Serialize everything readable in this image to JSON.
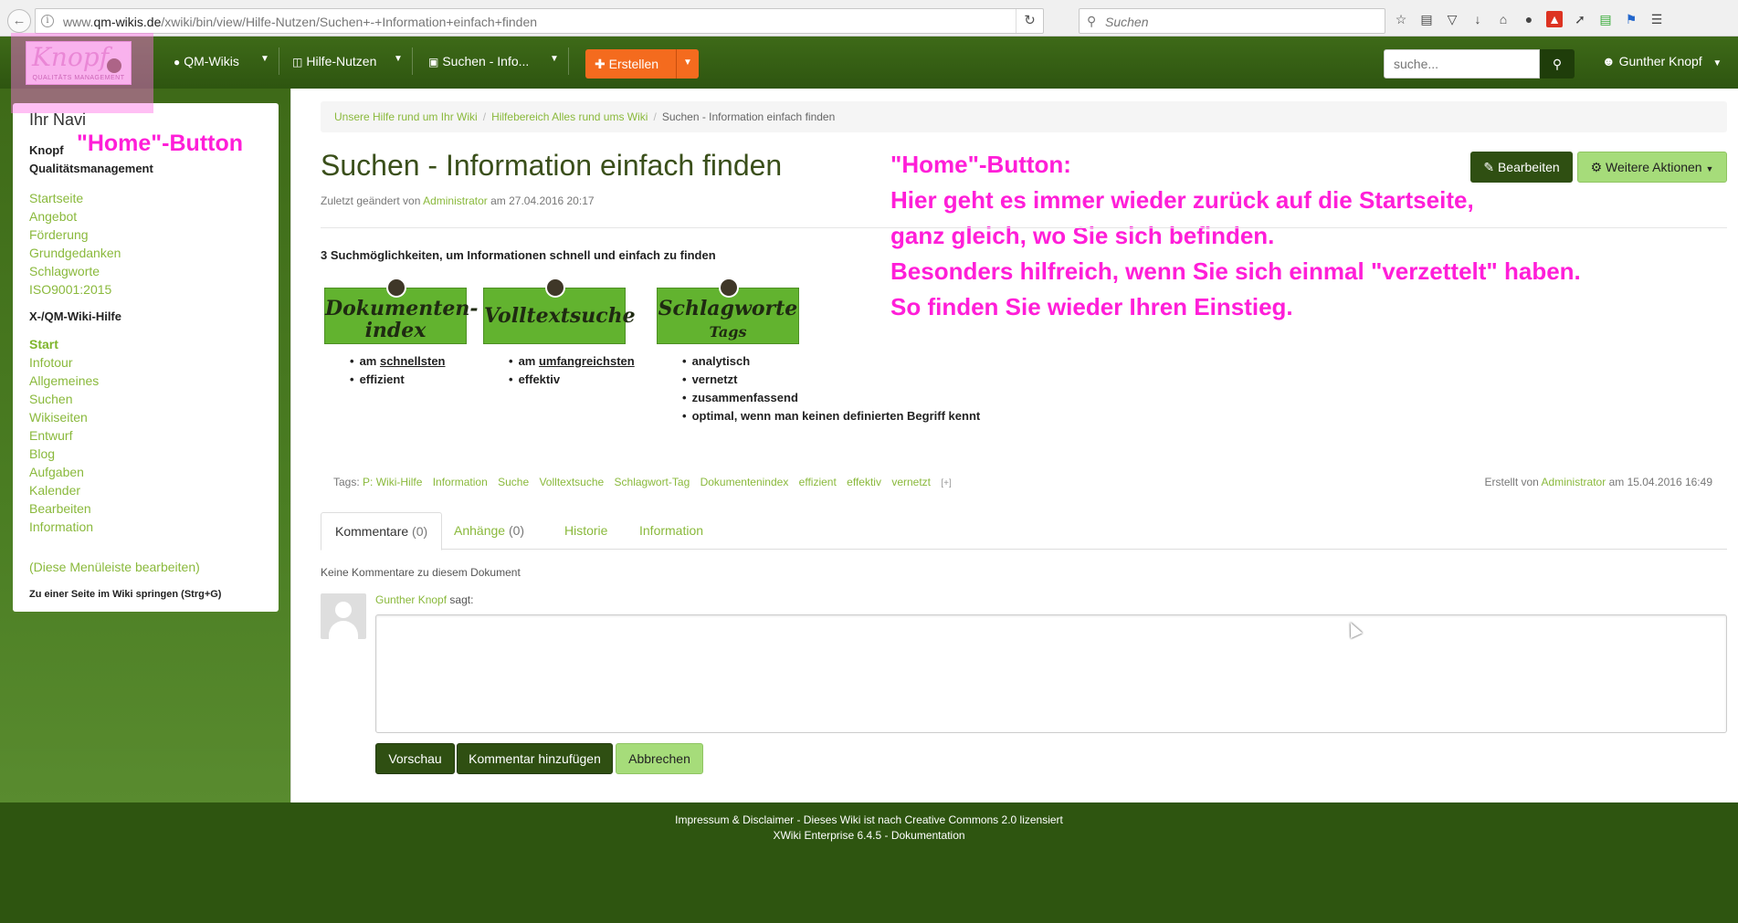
{
  "browser": {
    "url_prefix": "www.",
    "url_domain": "qm-wikis.de",
    "url_path": "/xwiki/bin/view/Hilfe-Nutzen/Suchen+-+Information+einfach+finden",
    "search_placeholder": "Suchen"
  },
  "header": {
    "logo_text": "Knopf",
    "logo_sub": "QUALITÄTS MANAGEMENT",
    "nav": [
      {
        "label": "QM-Wikis",
        "icon": "globe-icon"
      },
      {
        "label": "Hilfe-Nutzen",
        "icon": "folder-icon"
      },
      {
        "label": "Suchen - Info...",
        "icon": "document-icon"
      }
    ],
    "create_label": "Erstellen",
    "search_placeholder": "suche...",
    "user": "Gunther Knopf"
  },
  "sidebar": {
    "title": "Ihr Navi",
    "home_callout": "\"Home\"-Button",
    "section1_title_line1": "Knopf",
    "section1_title_line2": "Qualitätsmanagement",
    "section1_links": [
      "Startseite",
      "Angebot",
      "Förderung",
      "Grundgedanken",
      "Schlagworte",
      "ISO9001:2015"
    ],
    "section2_title": "X-/QM-Wiki-Hilfe",
    "section2_links": [
      "Start",
      "Infotour",
      "Allgemeines",
      "Suchen",
      "Wikiseiten",
      "Entwurf",
      "Blog",
      "Aufgaben",
      "Kalender",
      "Bearbeiten",
      "Information"
    ],
    "edit_menu": "(Diese Menüleiste bearbeiten)",
    "jump": "Zu einer Seite im Wiki springen (Strg+G)"
  },
  "breadcrumb": {
    "items": [
      "Unsere Hilfe rund um Ihr Wiki",
      "Hilfebereich Alles rund ums Wiki"
    ],
    "current": "Suchen - Information einfach finden"
  },
  "page": {
    "title": "Suchen - Information einfach finden",
    "modified_prefix": "Zuletzt geändert von",
    "modified_by": "Administrator",
    "modified_at": "am 27.04.2016 20:17",
    "edit_label": "Bearbeiten",
    "more_label": "Weitere Aktionen",
    "annotation_lines": [
      "\"Home\"-Button:",
      "Hier geht es immer wieder zurück auf die Startseite,",
      "ganz gleich, wo Sie sich befinden.",
      "Besonders hilfreich, wenn Sie sich einmal \"verzettelt\" haben.",
      "So finden Sie wieder Ihren Einstieg."
    ],
    "intro": "3 Suchmöglichkeiten, um Informationen schnell und einfach zu finden",
    "search_types": [
      {
        "box_line1": "Dokumenten-",
        "box_line2": "index",
        "bullets": [
          {
            "pre": "am ",
            "u": "schnellsten"
          },
          {
            "pre": "effizient",
            "u": ""
          }
        ]
      },
      {
        "box_line1": "Volltextsuche",
        "box_line2": "",
        "bullets": [
          {
            "pre": "am ",
            "u": "umfangreichsten"
          },
          {
            "pre": "effektiv",
            "u": ""
          }
        ]
      },
      {
        "box_line1": "Schlagworte",
        "box_line2": "Tags",
        "bullets": [
          {
            "pre": "analytisch",
            "u": ""
          },
          {
            "pre": "vernetzt",
            "u": ""
          },
          {
            "pre": "zusammenfassend",
            "u": ""
          },
          {
            "pre": "optimal, wenn man keinen definierten Begriff kennt",
            "u": ""
          }
        ]
      }
    ],
    "tags_label": "Tags:",
    "tags": [
      "P: Wiki-Hilfe",
      "Information",
      "Suche",
      "Volltextsuche",
      "Schlagwort-Tag",
      "Dokumentenindex",
      "effizient",
      "effektiv",
      "vernetzt"
    ],
    "tags_more": "[+]",
    "created_prefix": "Erstellt von",
    "created_by": "Administrator",
    "created_at": "am 15.04.2016 16:49"
  },
  "tabs": [
    {
      "label": "Kommentare",
      "count": "(0)"
    },
    {
      "label": "Anhänge",
      "count": "(0)"
    },
    {
      "label": "Historie",
      "count": ""
    },
    {
      "label": "Information",
      "count": ""
    }
  ],
  "comments": {
    "none": "Keine Kommentare zu diesem Dokument",
    "author": "Gunther Knopf",
    "says": "sagt:",
    "preview": "Vorschau",
    "add": "Kommentar hinzufügen",
    "cancel": "Abbrechen"
  },
  "footer": {
    "line1": "Impressum & Disclaimer - Dieses Wiki ist nach Creative Commons 2.0 lizensiert",
    "line2": "XWiki Enterprise 6.4.5 - Dokumentation"
  }
}
